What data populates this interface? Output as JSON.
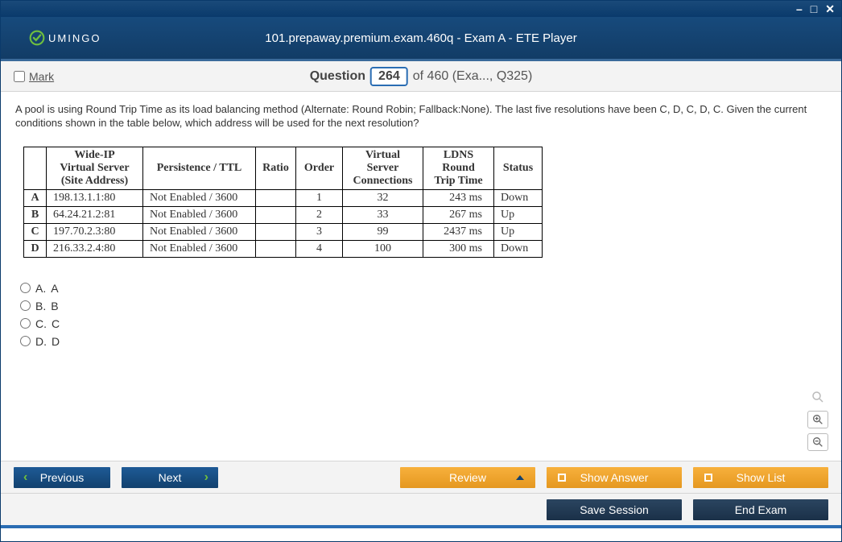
{
  "window": {
    "min_icon": "–",
    "max_icon": "□",
    "close_icon": "✕"
  },
  "brand": {
    "name": "UMINGO"
  },
  "header": {
    "title": "101.prepaway.premium.exam.460q - Exam A - ETE Player"
  },
  "questionbar": {
    "mark_label": "Mark",
    "q_label": "Question",
    "q_number": "264",
    "q_total_text": "of 460 (Exa..., Q325)"
  },
  "prompt": "A pool is using Round Trip Time as its load balancing method (Alternate: Round Robin; Fallback:None). The last five resolutions have been C, D, C, D, C. Given the current conditions shown in the table below, which address will be used for the next resolution?",
  "table": {
    "headers": {
      "wideip": "Wide-IP Virtual Server (Site Address)",
      "pers": "Persistence / TTL",
      "ratio": "Ratio",
      "order": "Order",
      "vsc": "Virtual Server Connections",
      "rtt": "LDNS Round Trip Time",
      "status": "Status"
    },
    "rows": [
      {
        "key": "A",
        "wideip": "198.13.1.1:80",
        "pers": "Not Enabled / 3600",
        "ratio": "",
        "order": "1",
        "vsc": "32",
        "rtt": "243 ms",
        "status": "Down"
      },
      {
        "key": "B",
        "wideip": "64.24.21.2:81",
        "pers": "Not Enabled / 3600",
        "ratio": "",
        "order": "2",
        "vsc": "33",
        "rtt": "267 ms",
        "status": "Up"
      },
      {
        "key": "C",
        "wideip": "197.70.2.3:80",
        "pers": "Not Enabled / 3600",
        "ratio": "",
        "order": "3",
        "vsc": "99",
        "rtt": "2437 ms",
        "status": "Up"
      },
      {
        "key": "D",
        "wideip": "216.33.2.4:80",
        "pers": "Not Enabled / 3600",
        "ratio": "",
        "order": "4",
        "vsc": "100",
        "rtt": "300 ms",
        "status": "Down"
      }
    ]
  },
  "options": [
    {
      "letter": "A.",
      "text": "A"
    },
    {
      "letter": "B.",
      "text": "B"
    },
    {
      "letter": "C.",
      "text": "C"
    },
    {
      "letter": "D.",
      "text": "D"
    }
  ],
  "buttons": {
    "previous": "Previous",
    "next": "Next",
    "review": "Review",
    "show_answer": "Show Answer",
    "show_list": "Show List",
    "save_session": "Save Session",
    "end_exam": "End Exam"
  }
}
